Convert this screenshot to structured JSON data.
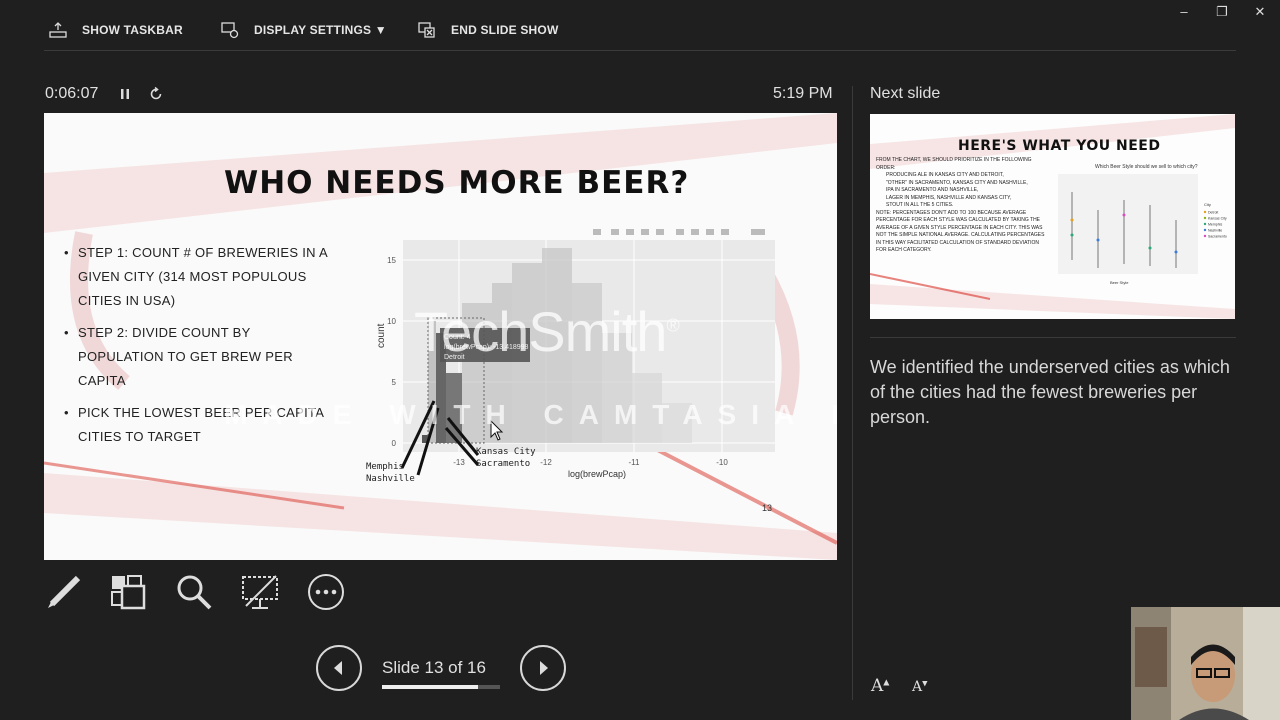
{
  "toolbar": {
    "show_taskbar": "SHOW TASKBAR",
    "display_settings": "DISPLAY SETTINGS ▼",
    "end_slide_show": "END SLIDE SHOW"
  },
  "window_controls": {
    "minimize": "–",
    "restore": "❐",
    "close": "✕"
  },
  "status": {
    "elapsed": "0:06:07",
    "clock": "5:19 PM"
  },
  "next_slide_label": "Next slide",
  "current_slide": {
    "title": "WHO NEEDS MORE BEER?",
    "bullets": [
      "Step 1: count # of breweries in a given city (314 most populous cities in USA)",
      "Step 2: divide count by population to get brew per capita",
      "Pick the lowest beer per capita cities to target"
    ],
    "slide_number": "13",
    "chart": {
      "ylabel": "count",
      "xlabel": "log(brewPcap)",
      "y_ticks": [
        "15",
        "10",
        "5",
        "0"
      ],
      "x_ticks": [
        "-13",
        "-12",
        "-11",
        "-10"
      ],
      "tooltip_count": "Count: 4",
      "tooltip_value": "log(brewPcap): -13.418998",
      "tooltip_city": "Detroit",
      "annotation_left_1": "Memphis",
      "annotation_left_2": "Nashville",
      "annotation_right_1": "Kansas City",
      "annotation_right_2": "Sacramento"
    },
    "watermark_1": "TechSmith",
    "watermark_reg": "®",
    "watermark_2": "MADE WITH CAMTASIA FREE TRIAL"
  },
  "navigation": {
    "counter": "Slide 13 of 16",
    "progress": 0.8125
  },
  "next_slide": {
    "title": "HERE'S WHAT YOU NEED",
    "text": [
      "From the chart, we should prioritize in the following order:",
      "Producing Ale in Kansas City and Detroit,",
      "\"Other\" in Sacramento, Kansas City and Nashville,",
      "IPA in Sacramento and Nashville,",
      "Lager in Memphis, Nashville and Kansas City,",
      "Stout in all the 5 cities.",
      "Note: percentages don't add to 100 because average percentage for each style was calculated by taking the average of a given style percentage in each city. This was not the simple national average. Calculating percentages in this way facilitated calculation of standard deviation for each category."
    ],
    "mini_chart_title": "Which Beer Style should we sell to which city?",
    "mini_chart_xlabel": "Beer Style",
    "mini_chart_legend_title": "City",
    "mini_chart_legend": [
      "Detroit",
      "Kansas City",
      "Memphis",
      "Nashville",
      "Sacramento"
    ]
  },
  "notes": "We identified the underserved cities as which of the cities had the fewest breweries per person.",
  "font_buttons": {
    "increase": "A",
    "decrease": "A"
  },
  "colors": {
    "background": "#1f1f1f",
    "accent_red": "#d9342b"
  }
}
